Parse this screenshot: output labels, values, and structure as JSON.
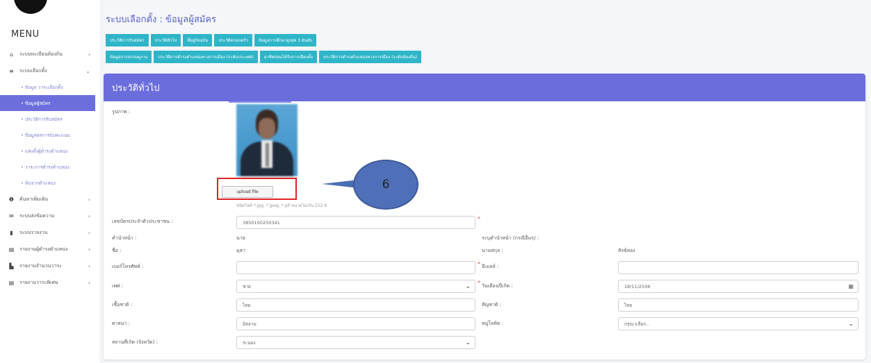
{
  "sidebar": {
    "menu_title": "MENU",
    "items": [
      {
        "icon": "bank-icon",
        "glyph": "⌂",
        "label": "ระบบทะเบียนท้องถิ่น",
        "chev": "‹"
      },
      {
        "icon": "list-icon",
        "glyph": "≡",
        "label": "ระบบเลือกตั้ง",
        "chev": "⌄"
      }
    ],
    "sub_items": [
      {
        "label": "• ข้อมูล วาระเลือกตั้ง",
        "active": false
      },
      {
        "label": "• ข้อมูลผู้สมัคร",
        "active": true
      },
      {
        "label": "• ประวัติการรับสมัคร",
        "active": false
      },
      {
        "label": "• ข้อมูลผลการนับคะแนน",
        "active": false
      },
      {
        "label": "• แต่งตั้งผู้ดำรงตำแหน่ง",
        "active": false
      },
      {
        "label": "• วาระการดำรงตำแหน่ง",
        "active": false
      },
      {
        "label": "• พ้นจากตำแหน่ง",
        "active": false
      }
    ],
    "bottom_items": [
      {
        "icon": "info-icon",
        "glyph": "❶",
        "label": "ค้นหาเพิ่มเติม",
        "chev": "‹"
      },
      {
        "icon": "mail-icon",
        "glyph": "✉",
        "label": "ระบบส่งข้อความ",
        "chev": "‹"
      },
      {
        "icon": "book-icon",
        "glyph": "▮",
        "label": "ระบบรายงาน",
        "chev": "‹"
      },
      {
        "icon": "report-icon",
        "glyph": "▤",
        "label": "รายงานผู้ดำรงตำแหน่ง",
        "chev": "‹"
      },
      {
        "icon": "chart-icon",
        "glyph": "▙",
        "label": "รายงานจำนวนวาระ",
        "chev": "‹"
      },
      {
        "icon": "doc-icon",
        "glyph": "▤",
        "label": "รายงานวาระพิเศษ",
        "chev": "‹"
      }
    ]
  },
  "header": {
    "title": "ระบบเลือกตั้ง : ข้อมูลผู้สมัคร"
  },
  "tabs_row1": [
    "ประวัติการรับสมัคร",
    "ประวัติทั่วไป",
    "ที่อยู่ปัจจุบัน",
    "ประวัติครอบครัว",
    "ข้อมูลการศึกษาสูงสุด 3 อันดับ"
  ],
  "tabs_row2": [
    "ข้อมูลการอบรมดูงาน",
    "ประวัติการดำรงตำแหน่งทางการเมือง (ระดับประเทศ)",
    "อาชีพก่อนได้รับการเลือกตั้ง",
    "ประวัติการดำรงตำแหน่งทางการเมือง (ระดับท้องถิ่น)"
  ],
  "card": {
    "title": "ประวัติทั่วไป",
    "photo_label": "รูปภาพ :",
    "upload_label": "upload file",
    "upload_hint": "ชนิดไฟล์ *.jpg, *.jpeg, *.gif ขนาดไม่เกิน 512 K",
    "callout_number": "6"
  },
  "form": {
    "id_label": "เลขบัตรประจำตัวประชาชน :",
    "id_value": "3850100250341",
    "prefix_label": "คำนำหน้า :",
    "prefix_value": "นาย",
    "prefix_other_label": "ระบุคำนำหน้า (กรณีอื่นๆ) :",
    "firstname_label": "ชื่อ :",
    "firstname_value": "มุสา",
    "lastname_label": "นามสกุล :",
    "lastname_value": "สังข์ทอง",
    "phone_label": "เบอร์โทรศัพท์ :",
    "phone_value": "",
    "email_label": "อีเมลล์ :",
    "email_value": "",
    "gender_label": "เพศ :",
    "gender_value": "ชาย",
    "birthdate_label": "วันเดือนปีเกิด :",
    "birthdate_value": "18/11/2506",
    "race_label": "เชื้อชาติ :",
    "race_value": "ไทย",
    "nationality_label": "สัญชาติ :",
    "nationality_value": "ไทย",
    "religion_label": "ศาสนา :",
    "religion_value": "อิสลาม",
    "blood_label": "หมู่โลหิต :",
    "blood_placeholder": "กรุณาเลือก..",
    "birthplace_label": "สถานที่เกิด (จังหวัด) :",
    "birthplace_value": "ระนอง"
  },
  "colors": {
    "accent": "#6a6ddb",
    "tab": "#2fb5c8",
    "highlight": "#e02020",
    "callout": "#4f6fb8"
  }
}
